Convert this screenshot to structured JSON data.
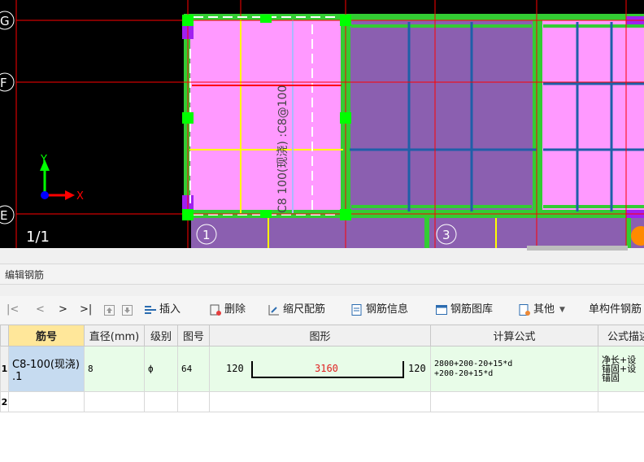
{
  "cad": {
    "axis_rows": [
      "G",
      "F",
      "E"
    ],
    "axis_cols": [
      "1",
      "3"
    ],
    "y_axis_label": "Y",
    "x_axis_label": "X",
    "page_label": "1/1",
    "rebar_annotation": "C8 100(现浇) :C8@100",
    "colors": {
      "background": "#000000",
      "slab_pink": "#ff99ff",
      "slab_purple": "#8b5fb0",
      "beam_green": "#33cc33",
      "grid_red": "#ff0000",
      "rebar_yellow": "#ffff00",
      "rebar_blue": "#1f5fa8"
    }
  },
  "panel": {
    "title": "编辑钢筋"
  },
  "toolbar": {
    "nav": [
      "|<",
      "<",
      ">",
      ">|"
    ],
    "insert": "插入",
    "delete": "删除",
    "scale": "缩尺配筋",
    "info": "钢筋信息",
    "library": "钢筋图库",
    "other": "其他",
    "single": "单构件钢筋"
  },
  "table": {
    "headers": [
      "筋号",
      "直径(mm)",
      "级别",
      "图号",
      "图形",
      "计算公式",
      "公式描述"
    ],
    "rows": [
      {
        "num": "1",
        "bar": "C8-100(现浇) .1",
        "diameter": "8",
        "grade": "ф",
        "figure_no": "64",
        "shape_left": "120",
        "shape_mid": "3160",
        "shape_right": "120",
        "formula_line1": "2800+200-20+15*d",
        "formula_line2": "+200-20+15*d",
        "description": "净长+设\n锚固+设\n锚固"
      },
      {
        "num": "2"
      }
    ]
  }
}
